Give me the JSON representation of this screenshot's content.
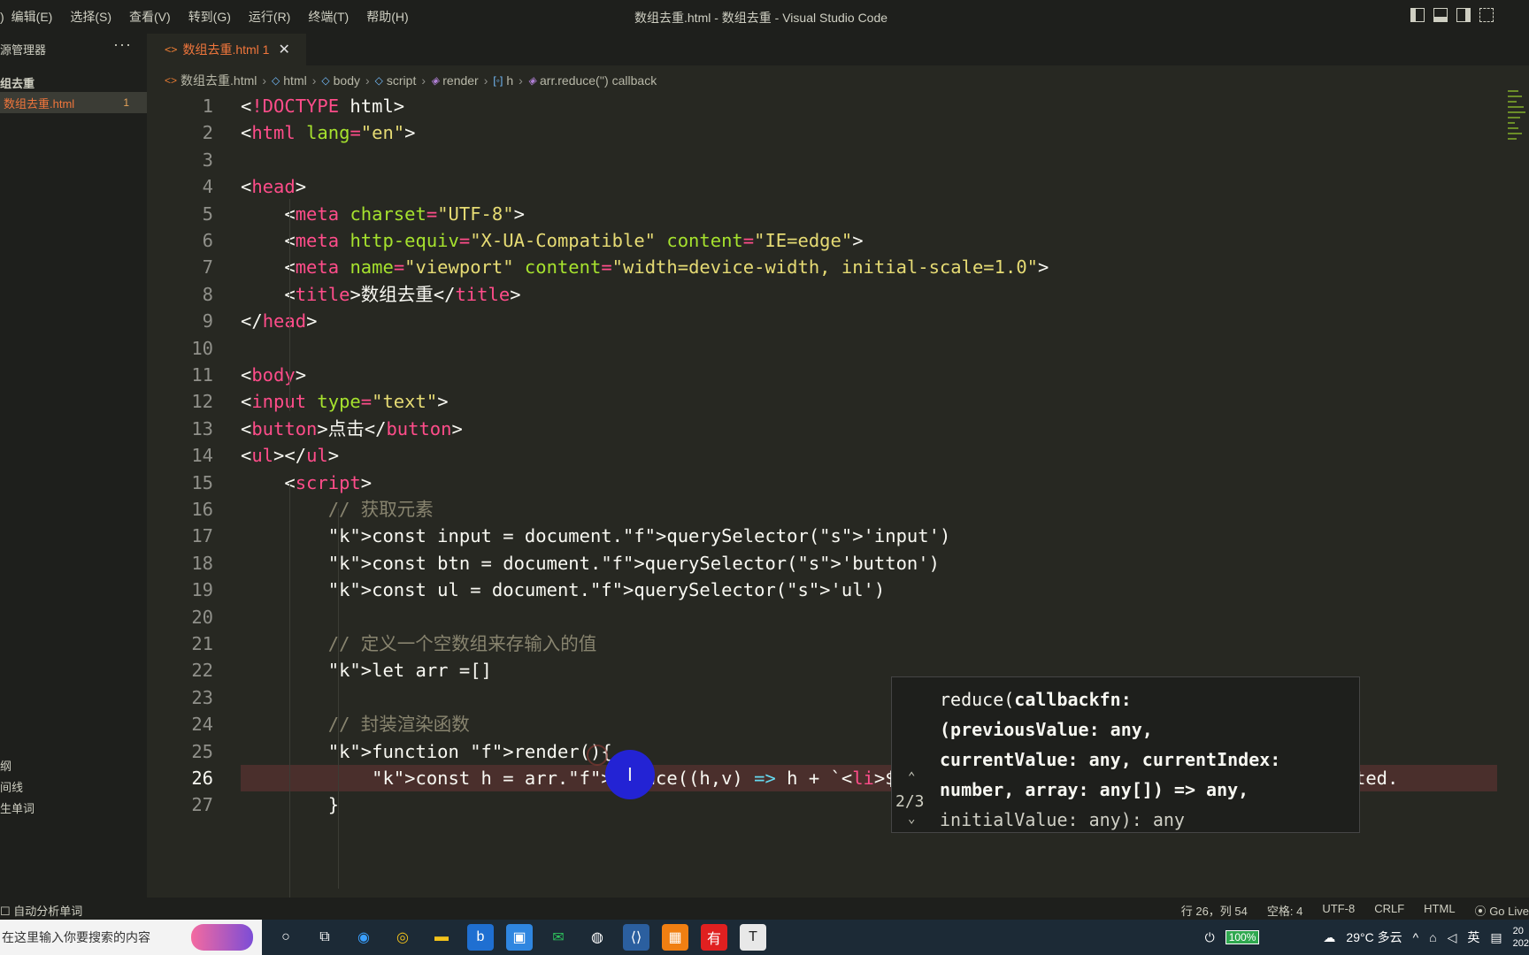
{
  "menu": [
    "编辑(E)",
    "选择(S)",
    "查看(V)",
    "转到(G)",
    "运行(R)",
    "终端(T)",
    "帮助(H)"
  ],
  "window_title": "数组去重.html - 数组去重 - Visual Studio Code",
  "sidebar": {
    "header": "源管理器",
    "more": "···",
    "folder": "组去重",
    "file": "数组去重.html",
    "file_problems": "1",
    "bottom": [
      "纲",
      "间线",
      "生单词"
    ]
  },
  "tab": {
    "icon": "<>",
    "name": "数组去重.html 1",
    "close": "✕"
  },
  "breadcrumb": [
    "数组去重.html",
    "html",
    "body",
    "script",
    "render",
    "h",
    "arr.reduce('') callback"
  ],
  "code_lines": [
    {
      "n": "1",
      "code": "<!DOCTYPE html>"
    },
    {
      "n": "2",
      "code": "<html lang=\"en\">"
    },
    {
      "n": "3",
      "code": ""
    },
    {
      "n": "4",
      "code": "<head>"
    },
    {
      "n": "5",
      "code": "    <meta charset=\"UTF-8\">"
    },
    {
      "n": "6",
      "code": "    <meta http-equiv=\"X-UA-Compatible\" content=\"IE=edge\">"
    },
    {
      "n": "7",
      "code": "    <meta name=\"viewport\" content=\"width=device-width, initial-scale=1.0\">"
    },
    {
      "n": "8",
      "code": "    <title>数组去重</title>"
    },
    {
      "n": "9",
      "code": "</head>"
    },
    {
      "n": "10",
      "code": ""
    },
    {
      "n": "11",
      "code": "<body>"
    },
    {
      "n": "12",
      "code": "<input type=\"text\">"
    },
    {
      "n": "13",
      "code": "<button>点击</button>"
    },
    {
      "n": "14",
      "code": "<ul></ul>"
    },
    {
      "n": "15",
      "code": "    <script>"
    },
    {
      "n": "16",
      "code": "        // 获取元素"
    },
    {
      "n": "17",
      "code": "        const input = document.querySelector('input')"
    },
    {
      "n": "18",
      "code": "        const btn = document.querySelector('button')"
    },
    {
      "n": "19",
      "code": "        const ul = document.querySelector('ul')"
    },
    {
      "n": "20",
      "code": ""
    },
    {
      "n": "21",
      "code": "        // 定义一个空数组来存输入的值"
    },
    {
      "n": "22",
      "code": "        let arr =[]"
    },
    {
      "n": "23",
      "code": ""
    },
    {
      "n": "24",
      "code": "        // 封装渲染函数"
    },
    {
      "n": "25",
      "code": "        function render(){"
    },
    {
      "n": "26",
      "code": "            const h = arr.reduce((h,v) => h + `<li>${}</li>`,'')    Expression expected."
    },
    {
      "n": "27",
      "code": "        }"
    }
  ],
  "hint": {
    "counter": "2/3",
    "line1": "reduce(",
    "line1b": "callbackfn:",
    "line2": "(previousValue: any,",
    "line3": "currentValue: any, currentIndex:",
    "line4": "number, array: any[]) => any,",
    "line5": "initialValue: any): any"
  },
  "status": {
    "left": "自动分析单词",
    "position": "行 26，列 54",
    "spaces": "空格: 4",
    "encoding": "UTF-8",
    "eol": "CRLF",
    "language": "HTML",
    "golive": "Go Live"
  },
  "taskbar": {
    "search_placeholder": "在这里输入你要搜索的内容",
    "battery": "100%",
    "weather": "29°C 多云",
    "ime": "英",
    "time": "20",
    "date": "202"
  }
}
